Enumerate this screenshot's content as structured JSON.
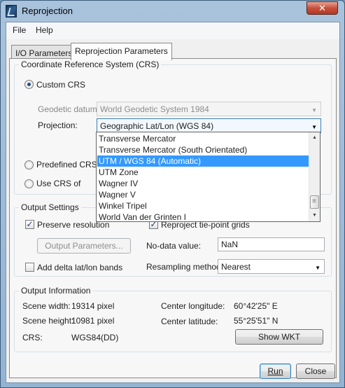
{
  "window": {
    "title": "Reprojection",
    "close_glyph": "✕",
    "icon": "snap-app-icon"
  },
  "menu": {
    "items": [
      "File",
      "Help"
    ]
  },
  "tabs": [
    "I/O Parameters",
    "Reprojection Parameters"
  ],
  "crs": {
    "title": "Coordinate Reference System (CRS)",
    "custom_label": "Custom CRS",
    "datum_label": "Geodetic datum:",
    "datum_value": "World Geodetic System 1984",
    "projection_label": "Projection:",
    "projection_value": "Geographic Lat/Lon (WGS 84)",
    "predefined_label": "Predefined CRS",
    "use_crs_label": "Use CRS of",
    "selected_option": "custom"
  },
  "projection_dropdown": {
    "items": [
      "Transverse Mercator",
      "Transverse Mercator (South Orientated)",
      "UTM / WGS 84 (Automatic)",
      "UTM Zone",
      "Wagner IV",
      "Wagner V",
      "Winkel Tripel",
      "World Van der Grinten I"
    ],
    "highlighted": "UTM / WGS 84 (Automatic)",
    "highlight_color": "#3399ff"
  },
  "output": {
    "title": "Output Settings",
    "preserve_resolution": "Preserve resolution",
    "preserve_checked": true,
    "reproject_tiepoint": "Reproject tie-point grids",
    "reproject_checked": true,
    "output_params_button": "Output Parameters...",
    "nodata_label": "No-data value:",
    "nodata_value": "NaN",
    "add_delta": "Add delta lat/lon bands",
    "add_delta_checked": false,
    "resampling_label": "Resampling method:",
    "resampling_value": "Nearest"
  },
  "info": {
    "title": "Output Information",
    "scene_width_label": "Scene width:",
    "scene_width_value": "19314 pixel",
    "scene_height_label": "Scene height:",
    "scene_height_value": "10981 pixel",
    "crs_label": "CRS:",
    "crs_value": "WGS84(DD)",
    "center_lon_label": "Center longitude:",
    "center_lon_value": "60°42'25\" E",
    "center_lat_label": "Center latitude:",
    "center_lat_value": "55°25'51\" N",
    "show_wkt_button": "Show WKT"
  },
  "footer": {
    "run_button": "Run",
    "close_button": "Close"
  }
}
